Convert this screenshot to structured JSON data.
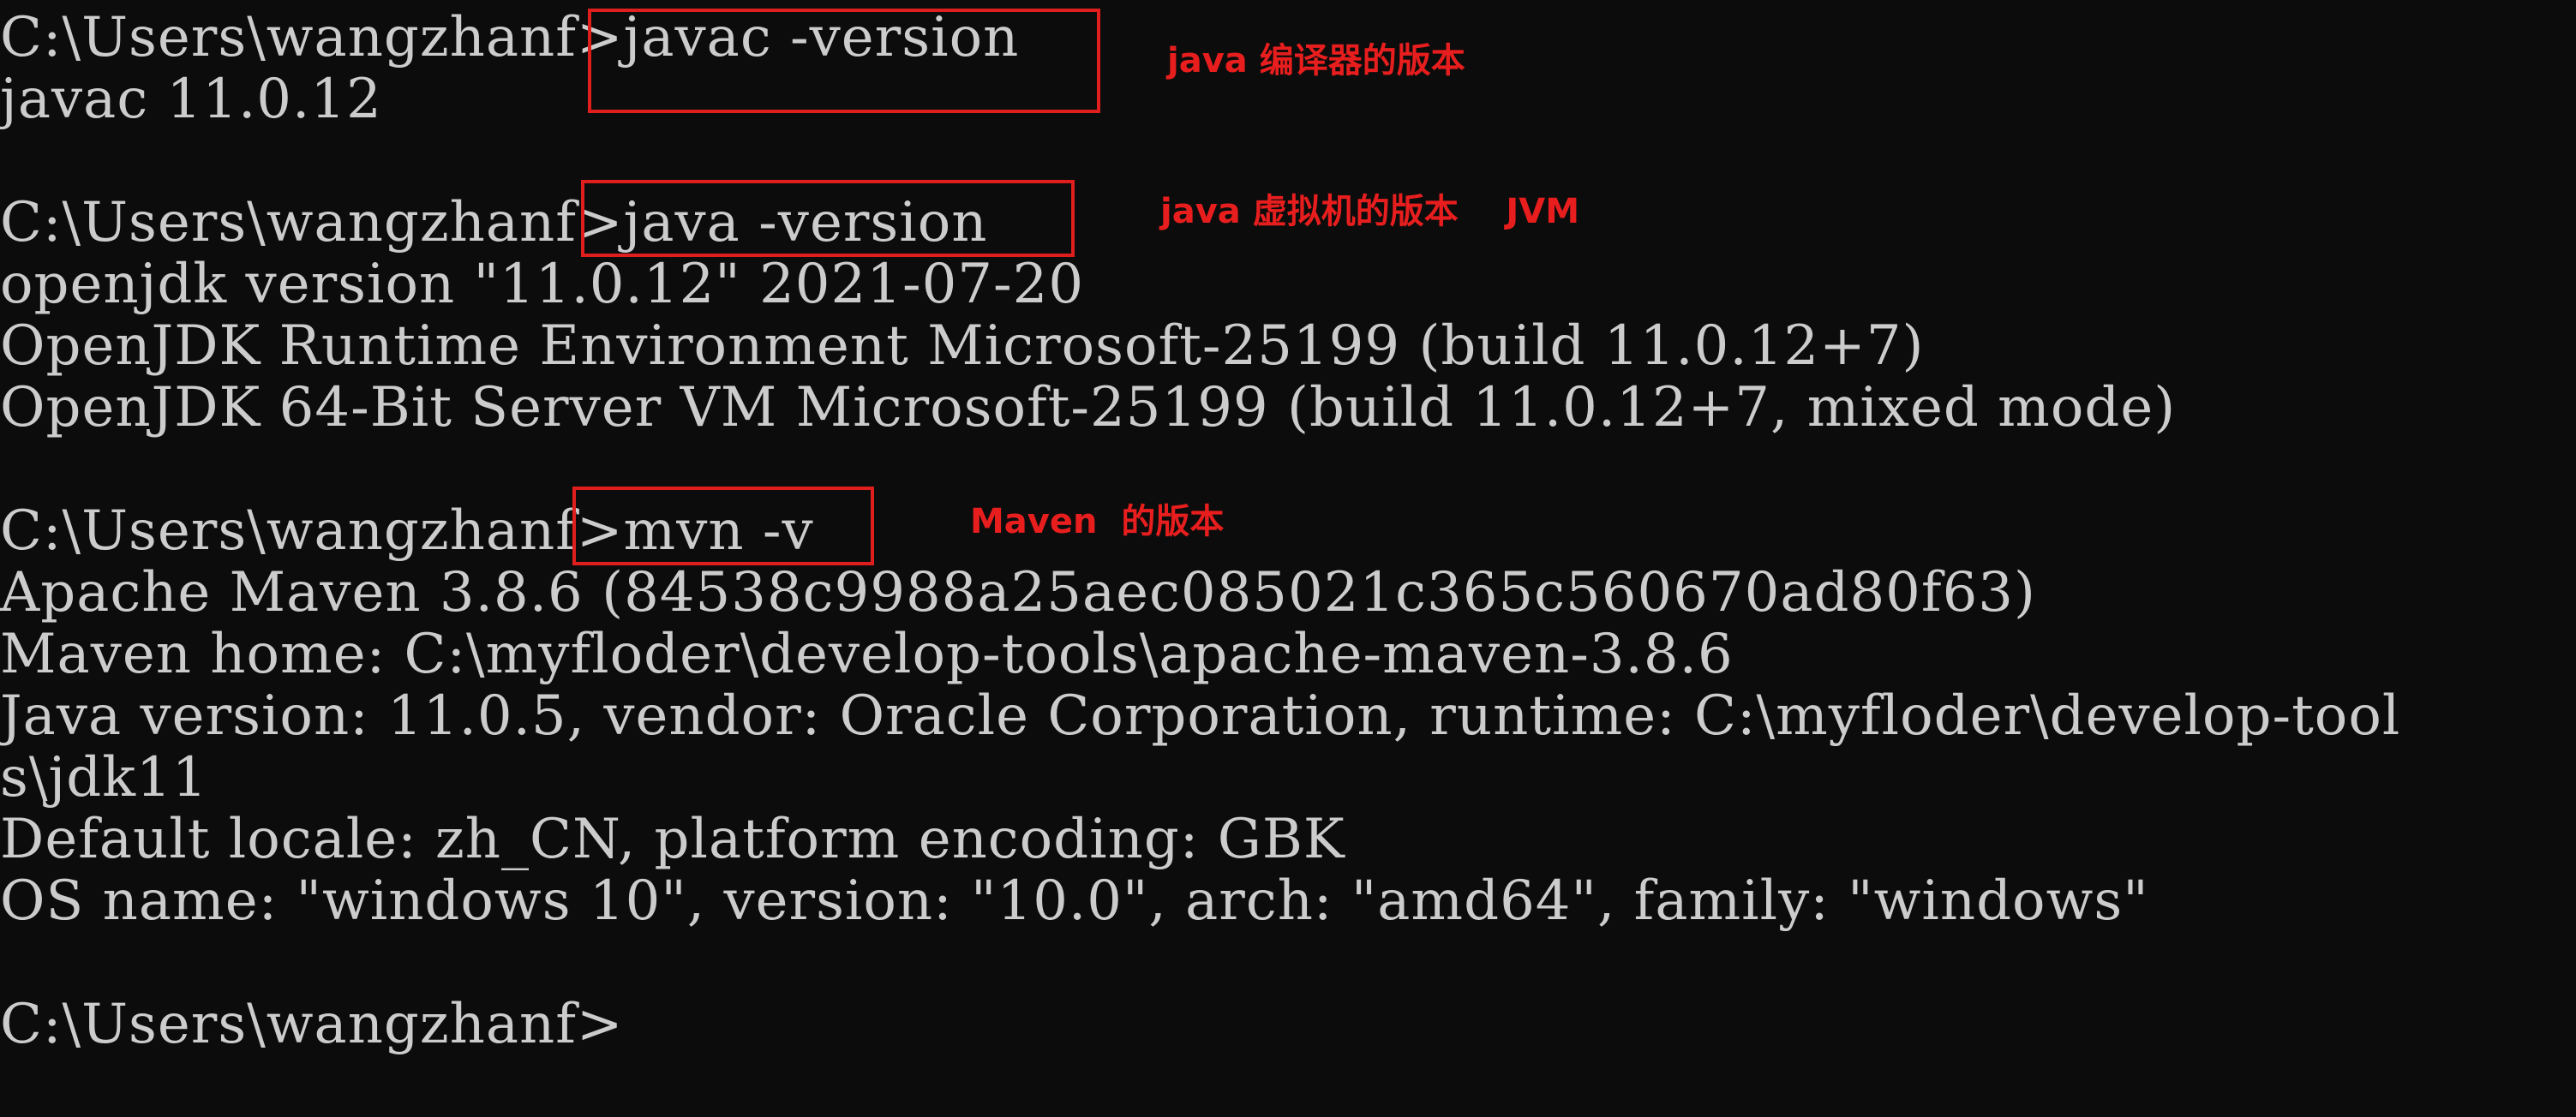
{
  "terminal": {
    "lines": {
      "l1_prompt": "C:\\Users\\wangzhanf>",
      "l1_cmd": "javac -version",
      "l2": "javac 11.0.12",
      "l4_prompt": "C:\\Users\\wangzhanf>",
      "l4_cmd": "java -version",
      "l5": "openjdk version \"11.0.12\" 2021-07-20",
      "l6": "OpenJDK Runtime Environment Microsoft-25199 (build 11.0.12+7)",
      "l7": "OpenJDK 64-Bit Server VM Microsoft-25199 (build 11.0.12+7, mixed mode)",
      "l9_prompt": "C:\\Users\\wangzhanf>",
      "l9_cmd": "mvn -v",
      "l10": "Apache Maven 3.8.6 (84538c9988a25aec085021c365c560670ad80f63)",
      "l11": "Maven home: C:\\myfloder\\develop-tools\\apache-maven-3.8.6",
      "l12": "Java version: 11.0.5, vendor: Oracle Corporation, runtime: C:\\myfloder\\develop-tool",
      "l13": "s\\jdk11",
      "l14": "Default locale: zh_CN, platform encoding: GBK",
      "l15": "OS name: \"windows 10\", version: \"10.0\", arch: \"amd64\", family: \"windows\"",
      "l17_prompt": "C:\\Users\\wangzhanf>"
    }
  },
  "annotations": {
    "javac_note": "java 编译器的版本",
    "java_note": "java 虚拟机的版本    JVM",
    "mvn_note": "Maven  的版本"
  },
  "colors": {
    "background": "#0c0c0c",
    "text": "#cccccc",
    "annotation": "#e81e1e"
  }
}
